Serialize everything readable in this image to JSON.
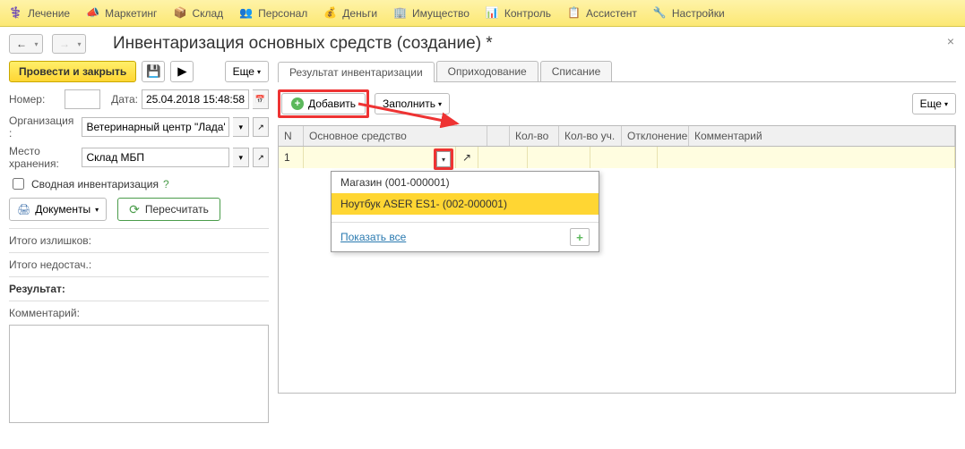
{
  "topmenu": {
    "items": [
      "Лечение",
      "Маркетинг",
      "Склад",
      "Персонал",
      "Деньги",
      "Имущество",
      "Контроль",
      "Ассистент",
      "Настройки"
    ]
  },
  "page_title": "Инвентаризация основных средств (создание) *",
  "left": {
    "post_close": "Провести и закрыть",
    "more": "Еще",
    "number_label": "Номер:",
    "number_value": "",
    "date_label": "Дата:",
    "date_value": "25.04.2018 15:48:58",
    "org_label": "Организация :",
    "org_value": "Ветеринарный центр \"Лада\"",
    "storage_label": "Место хранения:",
    "storage_value": "Склад МБП",
    "summary_inv": "Сводная инвентаризация",
    "documents_btn": "Документы",
    "recalc_btn": "Пересчитать",
    "total_surplus": "Итого излишков:",
    "total_shortage": "Итого недостач.:",
    "result": "Результат:",
    "comment_label": "Комментарий:"
  },
  "tabs": {
    "t1": "Результат инвентаризации",
    "t2": "Оприходование",
    "t3": "Списание"
  },
  "tab_toolbar": {
    "add": "Добавить",
    "fill": "Заполнить",
    "more": "Еще"
  },
  "table": {
    "h_n": "N",
    "h_asset": "Основное средство",
    "h_qty": "Кол-во",
    "h_qtyacc": "Кол-во уч.",
    "h_dev": "Отклонение",
    "h_comment": "Комментарий",
    "row1_n": "1"
  },
  "dropdown": {
    "item1": "Магазин  (001-000001)",
    "item2": "Ноутбук ASER ES1- (002-000001)",
    "show_all": "Показать все"
  }
}
